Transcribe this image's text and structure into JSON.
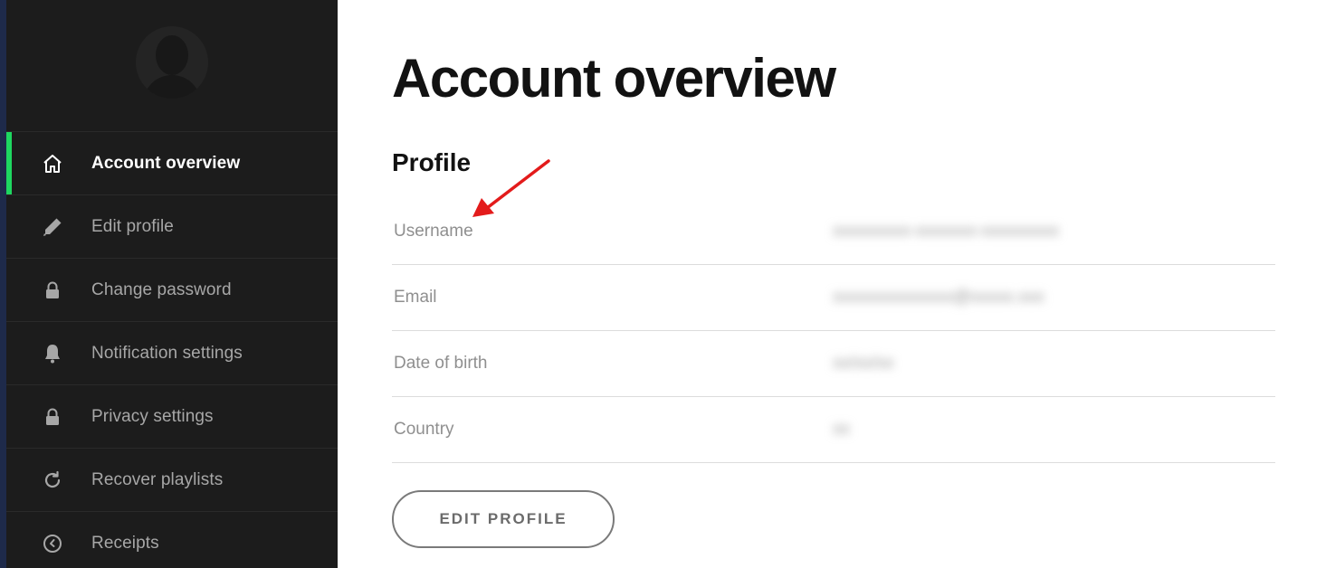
{
  "sidebar": {
    "items": [
      {
        "label": "Account overview",
        "icon": "home-icon",
        "active": true
      },
      {
        "label": "Edit profile",
        "icon": "pencil-icon",
        "active": false
      },
      {
        "label": "Change password",
        "icon": "lock-icon",
        "active": false
      },
      {
        "label": "Notification settings",
        "icon": "bell-icon",
        "active": false
      },
      {
        "label": "Privacy settings",
        "icon": "lock-icon",
        "active": false
      },
      {
        "label": "Recover playlists",
        "icon": "refresh-icon",
        "active": false
      },
      {
        "label": "Receipts",
        "icon": "clock-icon",
        "active": false
      }
    ]
  },
  "main": {
    "title": "Account overview",
    "profile": {
      "heading": "Profile",
      "rows": [
        {
          "label": "Username",
          "value": "(blurred)"
        },
        {
          "label": "Email",
          "value": "(blurred)"
        },
        {
          "label": "Date of birth",
          "value": "(blurred)"
        },
        {
          "label": "Country",
          "value": "(blurred)"
        }
      ]
    },
    "edit_button": "EDIT PROFILE"
  },
  "colors": {
    "accent": "#1ed760",
    "sidebar_bg": "#1c1c1c",
    "annotation_arrow": "#e31b1b"
  }
}
